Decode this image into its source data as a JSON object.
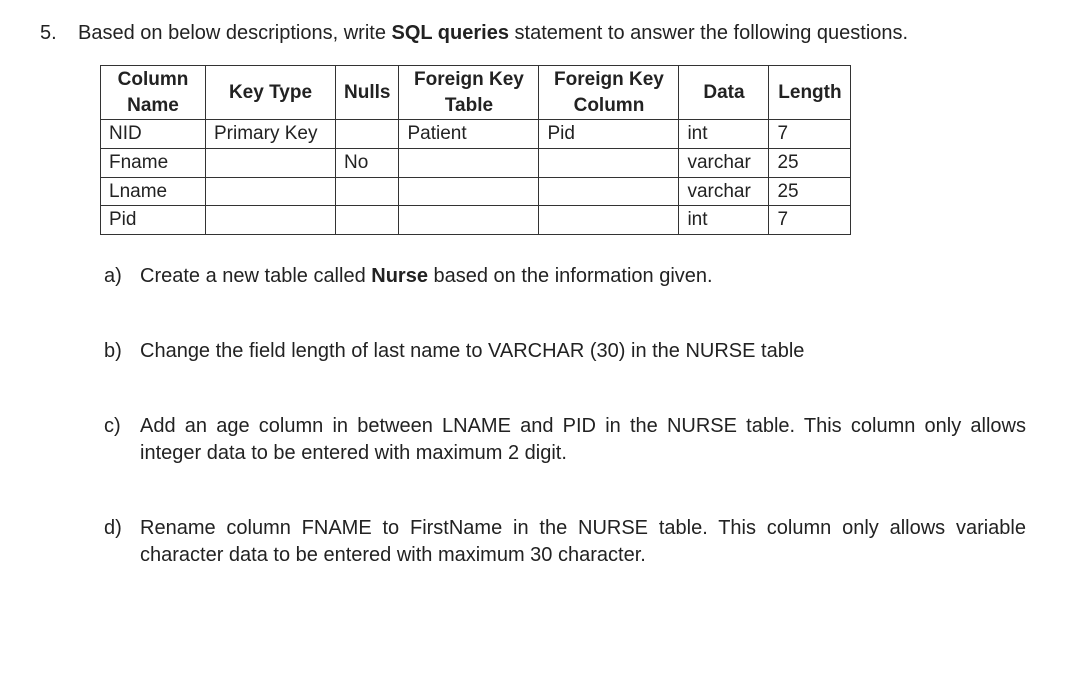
{
  "question_number": "5.",
  "intro_prefix": "Based on below descriptions, write ",
  "intro_bold": "SQL queries",
  "intro_suffix": " statement to answer the following questions.",
  "table": {
    "headers": {
      "column_name": "Column Name",
      "key_type": "Key Type",
      "nulls": "Nulls",
      "fk_table": "Foreign Key Table",
      "fk_column": "Foreign Key Column",
      "data": "Data",
      "length": "Length"
    },
    "rows": [
      {
        "column_name": "NID",
        "key_type": "Primary Key",
        "nulls": "",
        "fk_table": "Patient",
        "fk_column": "Pid",
        "data": "int",
        "length": "7"
      },
      {
        "column_name": "Fname",
        "key_type": "",
        "nulls": "No",
        "fk_table": "",
        "fk_column": "",
        "data": "varchar",
        "length": "25"
      },
      {
        "column_name": "Lname",
        "key_type": "",
        "nulls": "",
        "fk_table": "",
        "fk_column": "",
        "data": "varchar",
        "length": "25"
      },
      {
        "column_name": "Pid",
        "key_type": "",
        "nulls": "",
        "fk_table": "",
        "fk_column": "",
        "data": "int",
        "length": "7"
      }
    ]
  },
  "subquestions": {
    "a": {
      "label": "a)",
      "prefix": "Create a new table called ",
      "bold": "Nurse",
      "suffix": " based on the information given."
    },
    "b": {
      "label": "b)",
      "text": "Change the field length of last name to VARCHAR (30) in the NURSE table"
    },
    "c": {
      "label": "c)",
      "text": "Add an age column in between LNAME and PID in the NURSE table. This column only allows integer data to be entered with maximum 2 digit."
    },
    "d": {
      "label": "d)",
      "text": "Rename column FNAME to FirstName in the NURSE table. This column only allows variable character data to be entered with maximum 30 character."
    }
  }
}
